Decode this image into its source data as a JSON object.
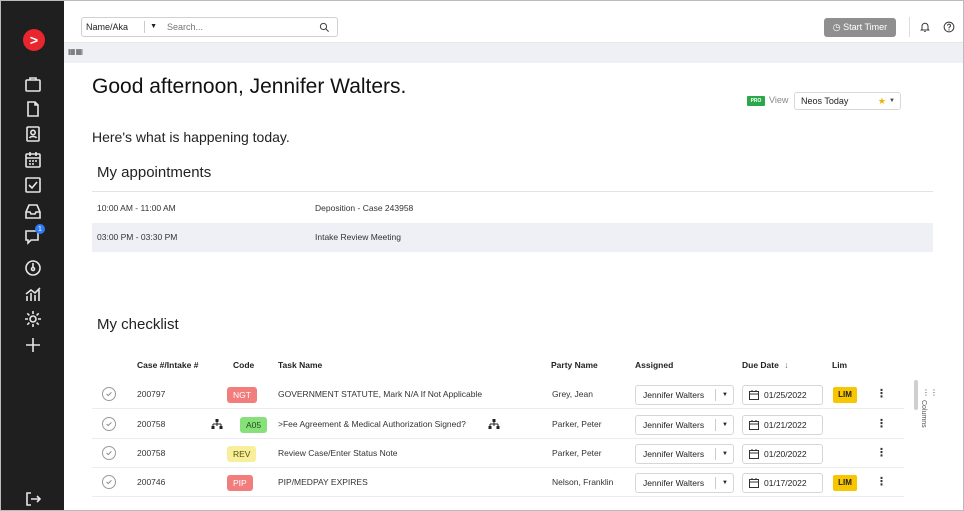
{
  "topbar": {
    "search_type": "Name/Aka",
    "search_placeholder": "Search...",
    "start_timer": "Start Timer"
  },
  "sidebar": {
    "items": [
      {
        "icon": "briefcase-icon"
      },
      {
        "icon": "document-icon"
      },
      {
        "icon": "contact-card-icon"
      },
      {
        "icon": "calendar-icon"
      },
      {
        "icon": "checkbox-icon"
      },
      {
        "icon": "inbox-icon"
      },
      {
        "icon": "chat-icon",
        "badge": "1"
      },
      {
        "icon": "gauge-icon"
      },
      {
        "icon": "chart-icon"
      },
      {
        "icon": "settings-icon"
      },
      {
        "icon": "plus-icon"
      }
    ],
    "logout_icon": "logout-icon"
  },
  "greeting": {
    "title": "Good afternoon, Jennifer Walters.",
    "subtitle": "Here's what is happening today."
  },
  "view": {
    "pro_label": "PRO",
    "label": "View",
    "selected": "Neos Today"
  },
  "appointments": {
    "heading": "My appointments",
    "rows": [
      {
        "time": "10:00 AM - 11:00 AM",
        "desc": "Deposition - Case 243958"
      },
      {
        "time": "03:00 PM - 03:30 PM",
        "desc": "Intake Review Meeting"
      }
    ]
  },
  "checklist": {
    "heading": "My checklist",
    "columns": {
      "case": "Case #/Intake #",
      "code": "Code",
      "task": "Task Name",
      "party": "Party Name",
      "assigned": "Assigned",
      "due": "Due Date",
      "lim": "Lim"
    },
    "side_tab": "Columns",
    "rows": [
      {
        "case": "200797",
        "code": "NGT",
        "code_bg": "#f27d7d",
        "code_fg": "#ffffff",
        "task": "GOVERNMENT STATUTE, Mark N/A If Not Applicable",
        "party": "Grey, Jean",
        "assigned": "Jennifer Walters",
        "due": "01/25/2022",
        "lim": "LIM",
        "tree": false
      },
      {
        "case": "200758",
        "code": "A05",
        "code_bg": "#88e07a",
        "code_fg": "#1f4d1a",
        "task": ">Fee Agreement & Medical Authorization Signed?",
        "party": "Parker, Peter",
        "assigned": "Jennifer Walters",
        "due": "01/21/2022",
        "lim": "",
        "tree": true
      },
      {
        "case": "200758",
        "code": "REV",
        "code_bg": "#f7ef9c",
        "code_fg": "#5a5200",
        "task": "Review Case/Enter Status Note",
        "party": "Parker, Peter",
        "assigned": "Jennifer Walters",
        "due": "01/20/2022",
        "lim": "",
        "tree": false
      },
      {
        "case": "200746",
        "code": "PIP",
        "code_bg": "#f27d7d",
        "code_fg": "#ffffff",
        "task": "PIP/MEDPAY EXPIRES",
        "party": "Nelson, Franklin",
        "assigned": "Jennifer Walters",
        "due": "01/17/2022",
        "lim": "LIM",
        "tree": false
      }
    ]
  }
}
